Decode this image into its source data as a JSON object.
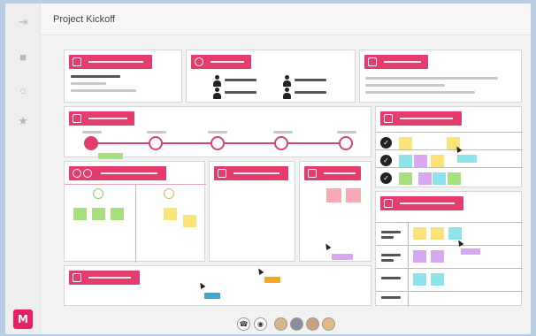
{
  "app": {
    "title": "Project Kickoff",
    "logo_letter": "M",
    "brand_color": "#e53d6b"
  },
  "rail": {
    "icons": [
      "sign-in-icon",
      "notes-icon",
      "comment-icon",
      "star-icon"
    ]
  },
  "footer": {
    "controls": [
      "audio-icon",
      "video-icon"
    ],
    "collaborators_count": 4
  }
}
